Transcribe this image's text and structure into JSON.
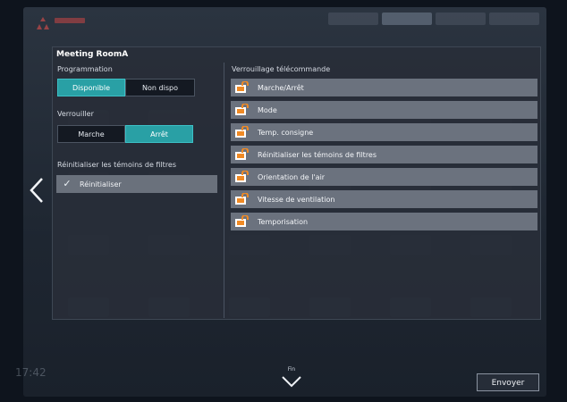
{
  "room_name": "Meeting RoomA",
  "schedule": {
    "label": "Programmation",
    "options": [
      "Disponible",
      "Non dispo"
    ],
    "selected": "Disponible"
  },
  "lock": {
    "label": "Verrouiller",
    "options": [
      "Marche",
      "Arrêt"
    ],
    "selected": "Arrêt"
  },
  "filter_reset": {
    "label": "Réinitialiser les témoins de filtres",
    "item_label": "Réinitialiser",
    "checked": true
  },
  "remote_lock": {
    "label": "Verrouillage télécommande",
    "items": [
      "Marche/Arrêt",
      "Mode",
      "Temp. consigne",
      "Réinitialiser les témoins de filtres",
      "Orientation de l'air",
      "Vitesse de ventilation",
      "Temporisation"
    ]
  },
  "footer": {
    "time": "17:42",
    "down_caption": "Fin",
    "send_label": "Envoyer"
  },
  "colors": {
    "accent_teal": "#29a0a5",
    "lock_icon": "#f08a24"
  },
  "icons": {
    "back": "chevron-left-icon",
    "down": "chevron-down-icon",
    "lock": "lock-icon",
    "check": "check-icon"
  }
}
